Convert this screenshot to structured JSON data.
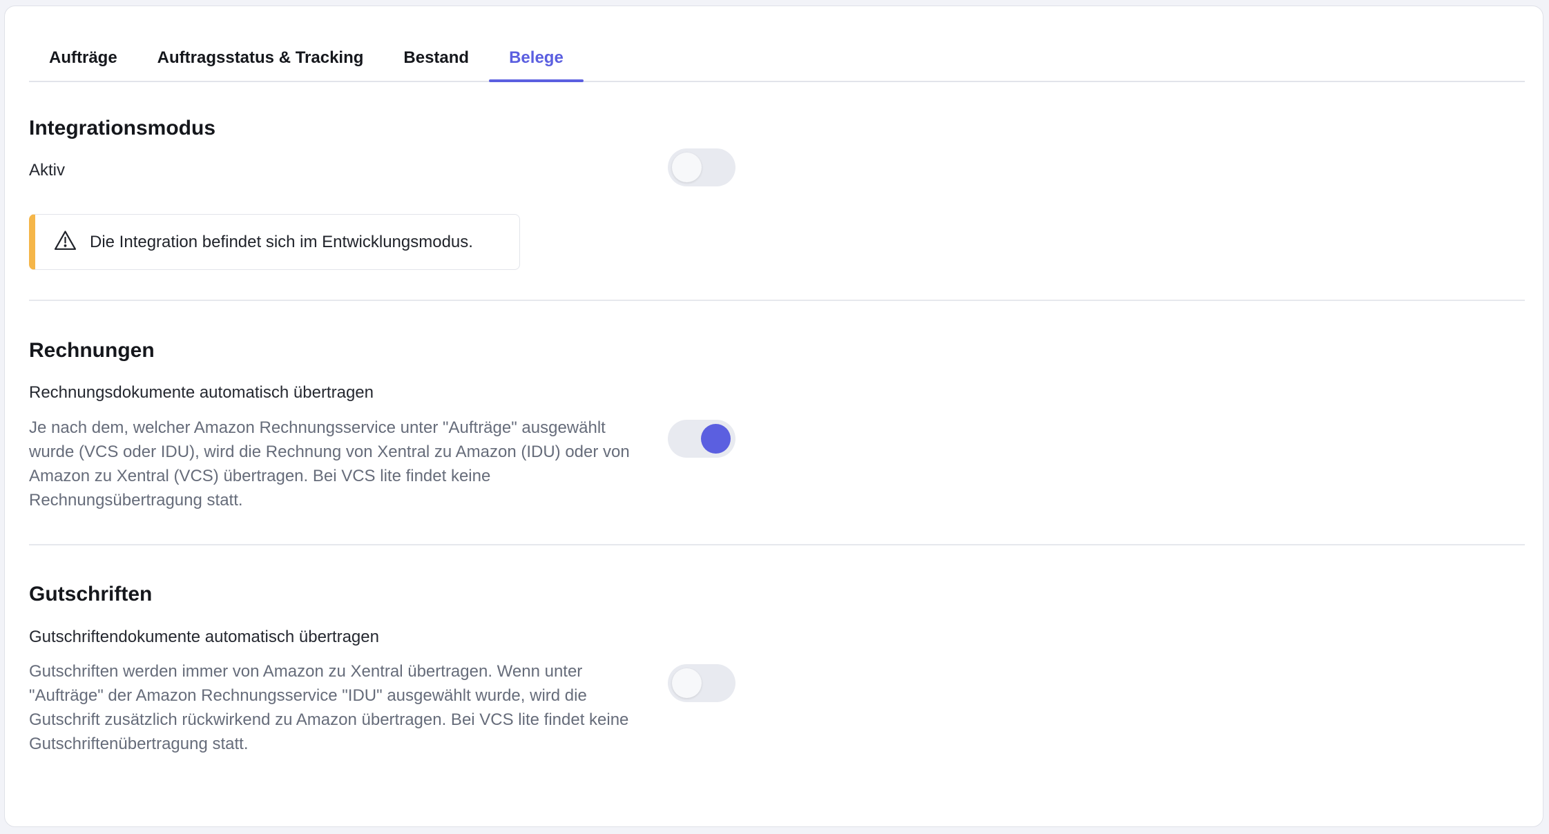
{
  "tabs": [
    {
      "label": "Aufträge",
      "active": false
    },
    {
      "label": "Auftragsstatus & Tracking",
      "active": false
    },
    {
      "label": "Bestand",
      "active": false
    },
    {
      "label": "Belege",
      "active": true
    }
  ],
  "integration": {
    "title": "Integrationsmodus",
    "label": "Aktiv",
    "toggle_on": false,
    "alert": {
      "icon": "warning-icon",
      "text": "Die Integration befindet sich im Entwicklungsmodus.",
      "accent_color": "#f5b649"
    }
  },
  "invoices": {
    "title": "Rechnungen",
    "label": "Rechnungsdokumente automatisch übertragen",
    "description": "Je nach dem, welcher Amazon Rechnungsservice unter \"Aufträge\" ausgewählt wurde (VCS oder IDU), wird die Rechnung von Xentral zu Amazon (IDU) oder von Amazon zu Xentral (VCS) übertragen. Bei VCS lite findet keine Rechnungsübertragung statt.",
    "toggle_on": true
  },
  "credits": {
    "title": "Gutschriften",
    "label": "Gutschriftendokumente automatisch übertragen",
    "description": "Gutschriften werden immer von Amazon zu Xentral übertragen. Wenn unter \"Aufträge\" der Amazon Rechnungsservice \"IDU\" ausgewählt wurde, wird die Gutschrift zusätzlich rückwirkend zu Amazon übertragen. Bei VCS lite findet keine Gutschriftenübertragung statt.",
    "toggle_on": false
  },
  "colors": {
    "accent": "#5b5fe0",
    "warning": "#f5b649"
  }
}
